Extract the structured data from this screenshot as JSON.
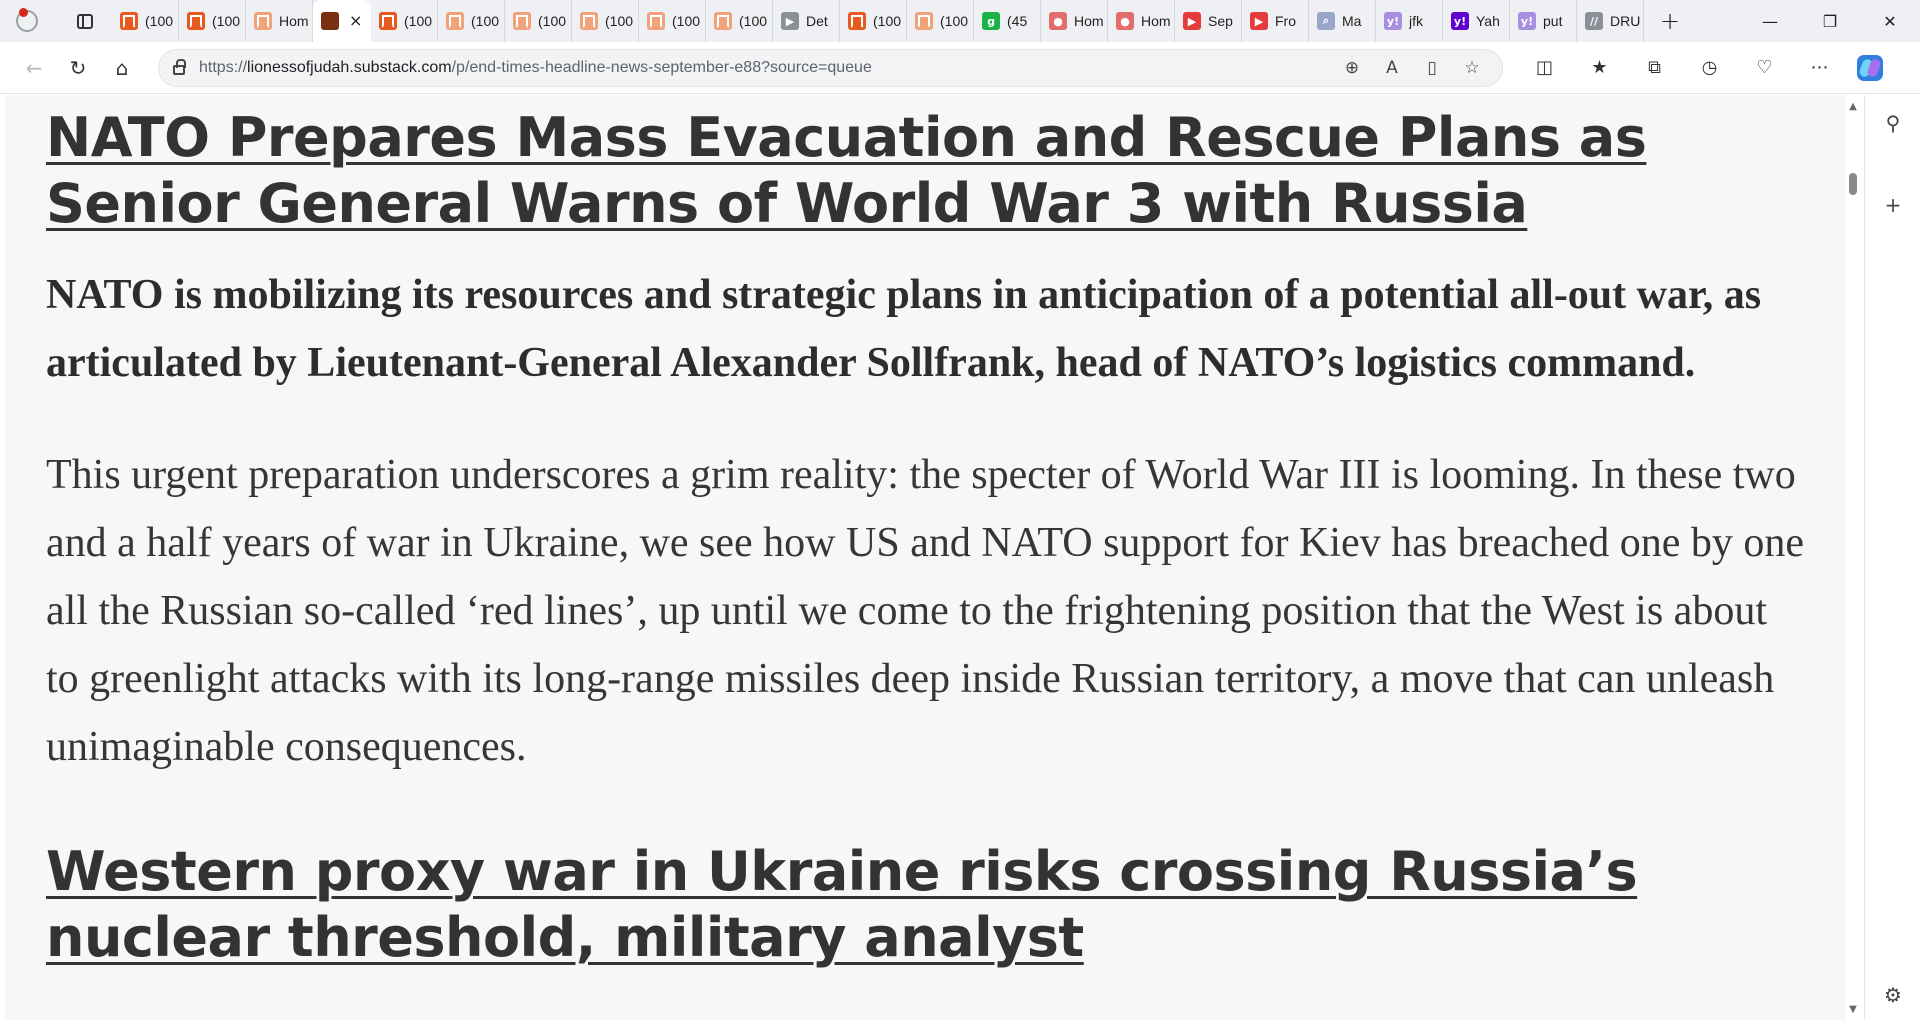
{
  "tabs": [
    {
      "title": "(100",
      "color": "#e8591f",
      "type": "bookmark"
    },
    {
      "title": "(100",
      "color": "#e8591f",
      "type": "bookmark"
    },
    {
      "title": "Hom",
      "color": "#f0a27a",
      "type": "bookmark"
    },
    {
      "title": "",
      "color": "#7a2f12",
      "type": "image",
      "active": true
    },
    {
      "title": "(100",
      "color": "#e8591f",
      "type": "bookmark"
    },
    {
      "title": "(100",
      "color": "#f0a27a",
      "type": "bookmark"
    },
    {
      "title": "(100",
      "color": "#f0a27a",
      "type": "bookmark"
    },
    {
      "title": "(100",
      "color": "#f0a27a",
      "type": "bookmark"
    },
    {
      "title": "(100",
      "color": "#f0a27a",
      "type": "bookmark"
    },
    {
      "title": "(100",
      "color": "#f0a27a",
      "type": "bookmark"
    },
    {
      "title": "Det",
      "color": "#8a8f98",
      "type": "arrow"
    },
    {
      "title": "(100",
      "color": "#e8591f",
      "type": "bookmark"
    },
    {
      "title": "(100",
      "color": "#f0a27a",
      "type": "bookmark"
    },
    {
      "title": "(45",
      "color": "#19b34a",
      "type": "letter",
      "glyph": "g"
    },
    {
      "title": "Hom",
      "color": "#e36c6c",
      "type": "person"
    },
    {
      "title": "Hom",
      "color": "#e36c6c",
      "type": "person"
    },
    {
      "title": "Sep",
      "color": "#e63b3b",
      "type": "play"
    },
    {
      "title": "Fro",
      "color": "#e63b3b",
      "type": "play"
    },
    {
      "title": "Ma",
      "color": "#9aa6c8",
      "type": "search"
    },
    {
      "title": "jfk",
      "color": "#a88fe0",
      "type": "letter",
      "glyph": "y!"
    },
    {
      "title": "Yah",
      "color": "#5f01d1",
      "type": "letter",
      "glyph": "y!"
    },
    {
      "title": "put",
      "color": "#a88fe0",
      "type": "letter",
      "glyph": "y!"
    },
    {
      "title": "DRU",
      "color": "#8a8f98",
      "type": "letter",
      "glyph": "//"
    }
  ],
  "active_tab_close": "×",
  "new_tab": "+",
  "window_controls": {
    "minimize": "—",
    "restore": "❐",
    "close": "✕"
  },
  "toolbar": {
    "back": "←",
    "refresh": "↻",
    "home": "⌂",
    "url_prefix": "https://",
    "url_host": "lionessofjudah.substack.com",
    "url_path": "/p/end-times-headline-news-september-e88?source=queue",
    "zoom_icon": "⊕",
    "read_aloud_icon": "A",
    "immersive_reader_icon": "▯",
    "favorite_icon": "☆",
    "split_screen_icon": "◫",
    "favorites_icon": "★",
    "collections_icon": "⧉",
    "history_icon": "◷",
    "performance_icon": "♡",
    "more_icon": "⋯"
  },
  "article": {
    "heading1": "NATO Prepares Mass Evacuation and Rescue Plans as Senior General Warns of World War 3 with Russia",
    "lead": "NATO is mobilizing its resources and strategic plans in anticipation of a potential all-out war, as articulated by Lieutenant-General Alexander Sollfrank, head of NATO’s logistics command.",
    "paragraph": "This urgent preparation underscores a grim reality: the specter of World War III is looming. In these two and a half years of war in Ukraine, we see how US and NATO support for Kiev has breached one by one all the Russian so-called ‘red lines’, up until we come to the frightening position that the West is about to greenlight attacks with its long-range missiles deep inside Russian territory, a move that can unleash unimaginable consequences.",
    "heading2": "Western proxy war in Ukraine risks crossing Russia’s nuclear threshold, military analyst"
  },
  "scrollbar": {
    "up": "▲",
    "down": "▼"
  },
  "sidebar": {
    "search": "⚲",
    "add": "+",
    "settings": "⚙"
  }
}
